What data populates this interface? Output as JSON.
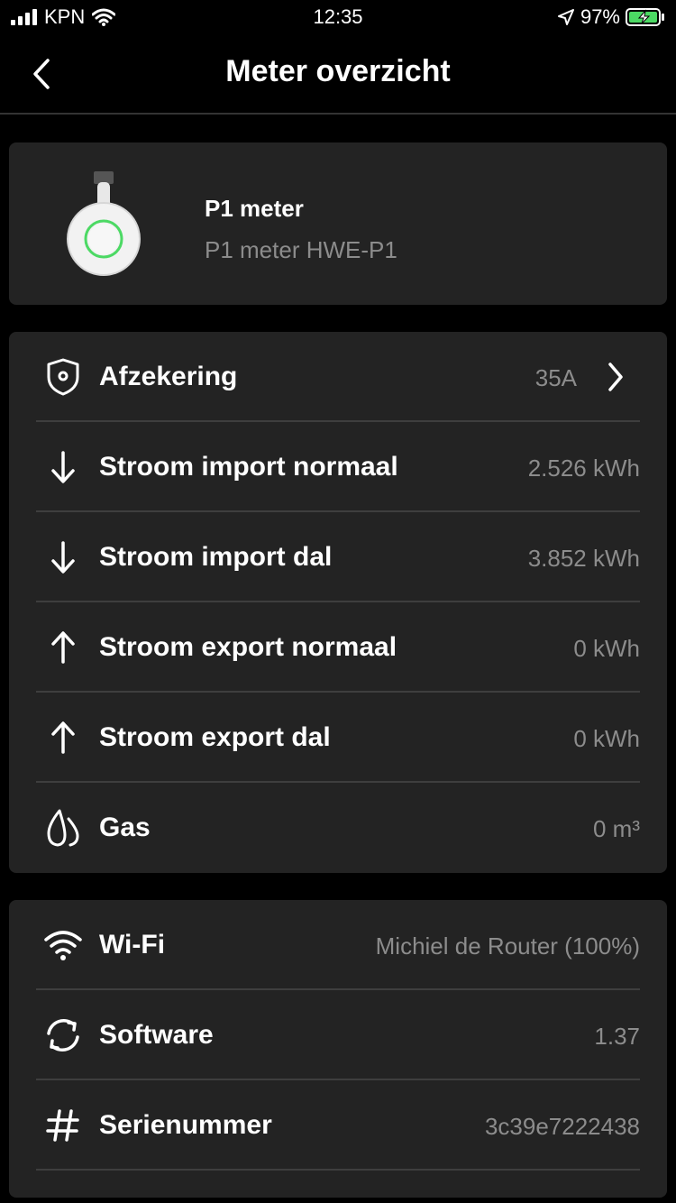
{
  "status_bar": {
    "carrier": "KPN",
    "time": "12:35",
    "battery": "97%"
  },
  "nav": {
    "title": "Meter overzicht"
  },
  "device": {
    "name": "P1 meter",
    "model": "P1 meter HWE-P1"
  },
  "meter_rows": [
    {
      "icon": "shield-icon",
      "label": "Afzekering",
      "value": "35A"
    },
    {
      "icon": "arrow-down-icon",
      "label": "Stroom import normaal",
      "value": "2.526 kWh"
    },
    {
      "icon": "arrow-down-icon",
      "label": "Stroom import dal",
      "value": "3.852 kWh"
    },
    {
      "icon": "arrow-up-icon",
      "label": "Stroom export normaal",
      "value": "0 kWh"
    },
    {
      "icon": "arrow-up-icon",
      "label": "Stroom export dal",
      "value": "0 kWh"
    },
    {
      "icon": "flame-icon",
      "label": "Gas",
      "value": "0 m³"
    }
  ],
  "info_rows": [
    {
      "icon": "wifi-icon",
      "label": "Wi-Fi",
      "value": "Michiel de Router (100%)"
    },
    {
      "icon": "refresh-icon",
      "label": "Software",
      "value": "1.37"
    },
    {
      "icon": "hash-icon",
      "label": "Serienummer",
      "value": "3c39e7222438"
    }
  ],
  "colors": {
    "background": "#000000",
    "card": "#232323",
    "secondary_text": "#8c8c8c",
    "accent_green": "#4cd964"
  }
}
